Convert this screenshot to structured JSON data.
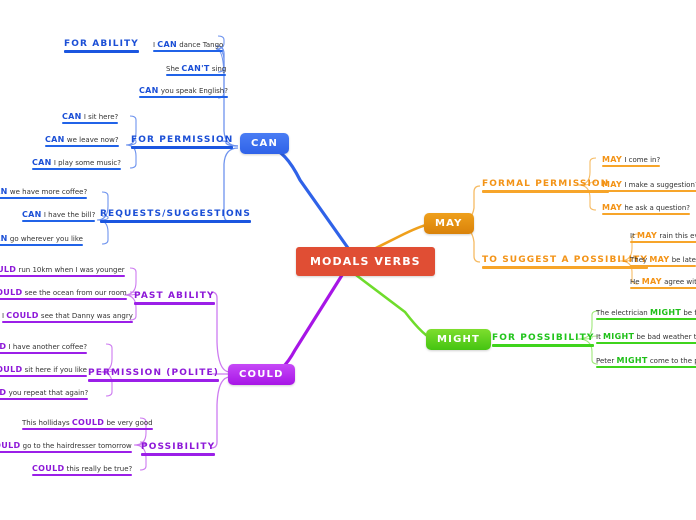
{
  "root": {
    "label": "MODALS VERBS",
    "color": "#e04e34"
  },
  "branches": [
    {
      "id": "can",
      "label": "CAN",
      "color": "#2f62e8",
      "categories": [
        {
          "label": "FOR ABILITY",
          "leaves": [
            {
              "pre": "I ",
              "kw": "CAN",
              "post": " dance Tango"
            },
            {
              "pre": "She ",
              "kw": "CAN'T",
              "post": " sing"
            },
            {
              "pre": "",
              "kw": "CAN",
              "post": " you speak English?"
            }
          ]
        },
        {
          "label": "FOR PERMISSION",
          "leaves": [
            {
              "pre": "",
              "kw": "CAN",
              "post": " I sit here?"
            },
            {
              "pre": "",
              "kw": "CAN",
              "post": " we leave now?"
            },
            {
              "pre": "",
              "kw": "CAN",
              "post": " I play some music?"
            }
          ]
        },
        {
          "label": "REQUESTS/SUGGESTIONS",
          "leaves": [
            {
              "pre": "",
              "kw": "CAN",
              "post": " we have more coffee?"
            },
            {
              "pre": "",
              "kw": "CAN",
              "post": " I have the bill?"
            },
            {
              "pre": "",
              "kw": "CAN",
              "post": " go wherever you like"
            }
          ]
        }
      ]
    },
    {
      "id": "may",
      "label": "MAY",
      "color": "#d9820a",
      "categories": [
        {
          "label": "FORMAL PERMISSION",
          "leaves": [
            {
              "pre": "",
              "kw": "MAY",
              "post": " I come in?"
            },
            {
              "pre": "",
              "kw": "MAY",
              "post": " I make a suggestion?"
            },
            {
              "pre": "",
              "kw": "MAY",
              "post": " he ask a question?"
            }
          ]
        },
        {
          "label": "TO SUGGEST A POSSIBILITY",
          "leaves": [
            {
              "pre": "It ",
              "kw": "MAY",
              "post": " rain this even"
            },
            {
              "pre": "They ",
              "kw": "MAY",
              "post": " be late"
            },
            {
              "pre": "He ",
              "kw": "MAY",
              "post": " agree with y"
            }
          ]
        }
      ]
    },
    {
      "id": "might",
      "label": "MIGHT",
      "color": "#44c411",
      "categories": [
        {
          "label": "FOR POSSIBILITY",
          "leaves": [
            {
              "pre": "The electrician ",
              "kw": "MIGHT",
              "post": " be finish"
            },
            {
              "pre": "It ",
              "kw": "MIGHT",
              "post": " be bad weather tomo"
            },
            {
              "pre": "Peter ",
              "kw": "MIGHT",
              "post": " come to the party"
            }
          ]
        }
      ]
    },
    {
      "id": "could",
      "label": "COULD",
      "color": "#a715e6",
      "categories": [
        {
          "label": "PAST ABILITY",
          "leaves": [
            {
              "pre": "",
              "kw": "OULD",
              "post": " run 10km when I was younger"
            },
            {
              "pre": "",
              "kw": "COULD",
              "post": " see the ocean from our room"
            },
            {
              "pre": "I ",
              "kw": "COULD",
              "post": " see that Danny was angry"
            }
          ]
        },
        {
          "label": "PERMISSION (POLITE)",
          "leaves": [
            {
              "pre": "",
              "kw": "LD",
              "post": " I have another coffee?"
            },
            {
              "pre": "",
              "kw": "COULD",
              "post": " sit here if you like"
            },
            {
              "pre": "",
              "kw": "LD",
              "post": " you repeat that again?"
            }
          ]
        },
        {
          "label": "POSSIBILITY",
          "leaves": [
            {
              "pre": "This hollidays ",
              "kw": "COULD",
              "post": " be very good"
            },
            {
              "pre": "",
              "kw": "COULD",
              "post": " go to the hairdresser tomorrow"
            },
            {
              "pre": "",
              "kw": "COULD",
              "post": " this really be true?"
            }
          ]
        }
      ]
    }
  ]
}
